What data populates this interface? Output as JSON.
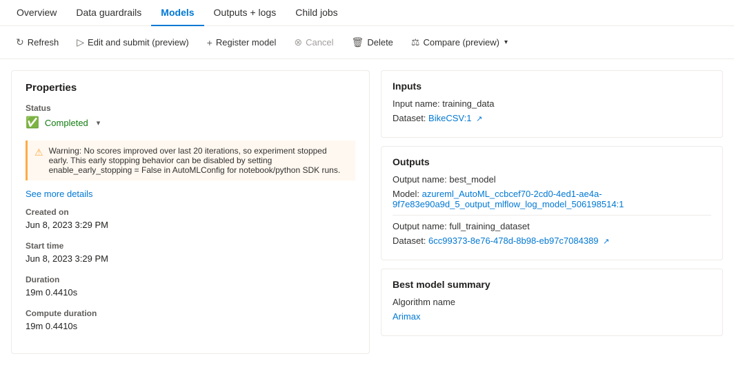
{
  "tabs": [
    {
      "id": "overview",
      "label": "Overview",
      "active": false
    },
    {
      "id": "data-guardrails",
      "label": "Data guardrails",
      "active": false
    },
    {
      "id": "models",
      "label": "Models",
      "active": true
    },
    {
      "id": "outputs-logs",
      "label": "Outputs + logs",
      "active": false
    },
    {
      "id": "child-jobs",
      "label": "Child jobs",
      "active": false
    }
  ],
  "toolbar": {
    "refresh": "Refresh",
    "edit_submit": "Edit and submit (preview)",
    "register_model": "Register model",
    "cancel": "Cancel",
    "delete": "Delete",
    "compare": "Compare (preview)"
  },
  "left_panel": {
    "title": "Properties",
    "status_label": "Status",
    "status_value": "Completed",
    "warning_text": "Warning: No scores improved over last 20 iterations, so experiment stopped early. This early stopping behavior can be disabled by setting enable_early_stopping = False in AutoMLConfig for notebook/python SDK runs.",
    "see_more": "See more details",
    "created_on_label": "Created on",
    "created_on_value": "Jun 8, 2023 3:29 PM",
    "start_time_label": "Start time",
    "start_time_value": "Jun 8, 2023 3:29 PM",
    "duration_label": "Duration",
    "duration_value": "19m 0.4410s",
    "compute_duration_label": "Compute duration",
    "compute_duration_value": "19m 0.4410s"
  },
  "inputs_card": {
    "title": "Inputs",
    "input_name_label": "Input name: training_data",
    "dataset_label": "Dataset:",
    "dataset_link": "BikeCSV:1"
  },
  "outputs_card": {
    "title": "Outputs",
    "output1_name": "Output name: best_model",
    "model_label": "Model:",
    "model_link": "azureml_AutoML_ccbcef70-2cd0-4ed1-ae4a-9f7e83e90a9d_5_output_mlflow_log_model_506198514:1",
    "output2_name": "Output name: full_training_dataset",
    "dataset2_label": "Dataset:",
    "dataset2_link": "6cc99373-8e76-478d-8b98-eb97c7084389"
  },
  "best_model_card": {
    "title": "Best model summary",
    "algorithm_name_label": "Algorithm name",
    "algorithm_link": "Arimax"
  }
}
